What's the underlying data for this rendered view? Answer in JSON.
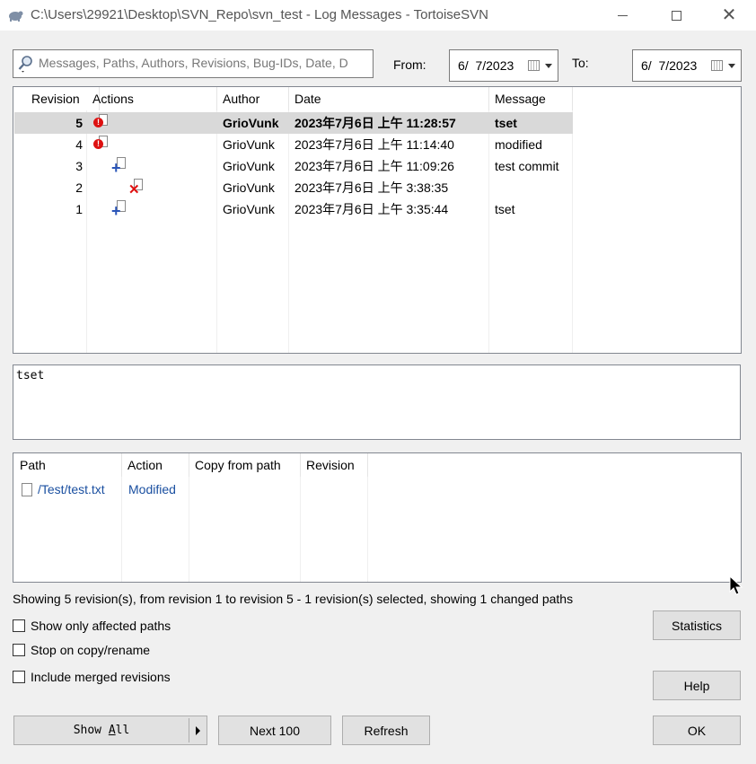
{
  "window": {
    "title": "C:\\Users\\29921\\Desktop\\SVN_Repo\\svn_test - Log Messages - TortoiseSVN"
  },
  "filter": {
    "search_placeholder": "Messages, Paths, Authors, Revisions, Bug-IDs, Date, D",
    "from_label": "From:",
    "from_value": "6/  7/2023",
    "to_label": "To:",
    "to_value": "6/  7/2023"
  },
  "revisions": {
    "headers": [
      "Revision",
      "Actions",
      "Author",
      "Date",
      "Message"
    ],
    "rows": [
      {
        "revision": "5",
        "action": "modified",
        "author": "GrioVunk",
        "date": "2023年7月6日 上午 11:28:57",
        "message": "tset",
        "selected": true
      },
      {
        "revision": "4",
        "action": "modified",
        "author": "GrioVunk",
        "date": "2023年7月6日 上午 11:14:40",
        "message": "modified",
        "selected": false
      },
      {
        "revision": "3",
        "action": "added",
        "author": "GrioVunk",
        "date": "2023年7月6日 上午 11:09:26",
        "message": "test commit",
        "selected": false
      },
      {
        "revision": "2",
        "action": "deleted",
        "author": "GrioVunk",
        "date": "2023年7月6日 上午 3:38:35",
        "message": "",
        "selected": false
      },
      {
        "revision": "1",
        "action": "added",
        "author": "GrioVunk",
        "date": "2023年7月6日 上午 3:35:44",
        "message": "tset",
        "selected": false
      }
    ]
  },
  "message_box": {
    "text": "tset"
  },
  "paths": {
    "headers": [
      "Path",
      "Action",
      "Copy from path",
      "Revision"
    ],
    "rows": [
      {
        "path": "/Test/test.txt",
        "action": "Modified",
        "copy_from": "",
        "revision": ""
      }
    ]
  },
  "status": {
    "text": "Showing 5 revision(s), from revision 1 to revision 5 - 1 revision(s) selected, showing 1 changed paths"
  },
  "options": {
    "show_only_affected": "Show only affected paths",
    "stop_on_copy": "Stop on copy/rename",
    "include_merged": "Include merged revisions"
  },
  "buttons": {
    "statistics": "Statistics",
    "help": "Help",
    "show_all": "Show All",
    "show_all_accel": "A",
    "next_100": "Next 100",
    "refresh": "Refresh",
    "ok": "OK"
  },
  "colors": {
    "selected_row": "#d9d9d9",
    "link_blue": "#1a4fa0",
    "modified_red": "#d11111",
    "added_blue": "#2a55b8"
  }
}
